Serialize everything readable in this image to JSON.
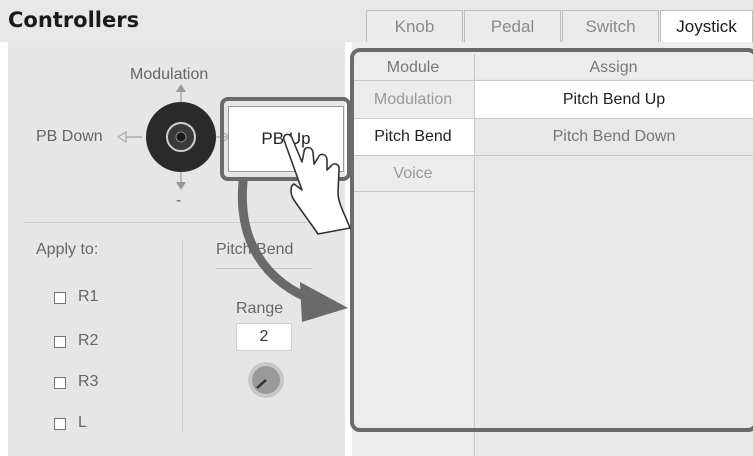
{
  "header": {
    "title": "Controllers",
    "tabs": [
      {
        "label": "Knob",
        "active": false
      },
      {
        "label": "Pedal",
        "active": false
      },
      {
        "label": "Switch",
        "active": false
      },
      {
        "label": "Joystick",
        "active": true
      }
    ]
  },
  "joystick": {
    "up_label": "Modulation",
    "left_label": "PB Down",
    "right_label": "PB Up",
    "down_label": "-"
  },
  "apply": {
    "heading": "Apply to:",
    "parts": [
      "R1",
      "R2",
      "R3",
      "L"
    ]
  },
  "pitch_bend": {
    "heading": "Pitch Bend",
    "range_label": "Range",
    "range_value": "2"
  },
  "table": {
    "module_header": "Module",
    "assign_header": "Assign",
    "modules": [
      "Modulation",
      "Pitch Bend",
      "Voice"
    ],
    "selected_module": "Pitch Bend",
    "assign_options": [
      "Pitch Bend Up",
      "Pitch Bend Down"
    ],
    "selected_assign": "Pitch Bend Up"
  },
  "colors": {
    "highlight_outline": "#6a6a6a",
    "arrow": "#6a6a6a",
    "knob": "#2a2a2a"
  }
}
